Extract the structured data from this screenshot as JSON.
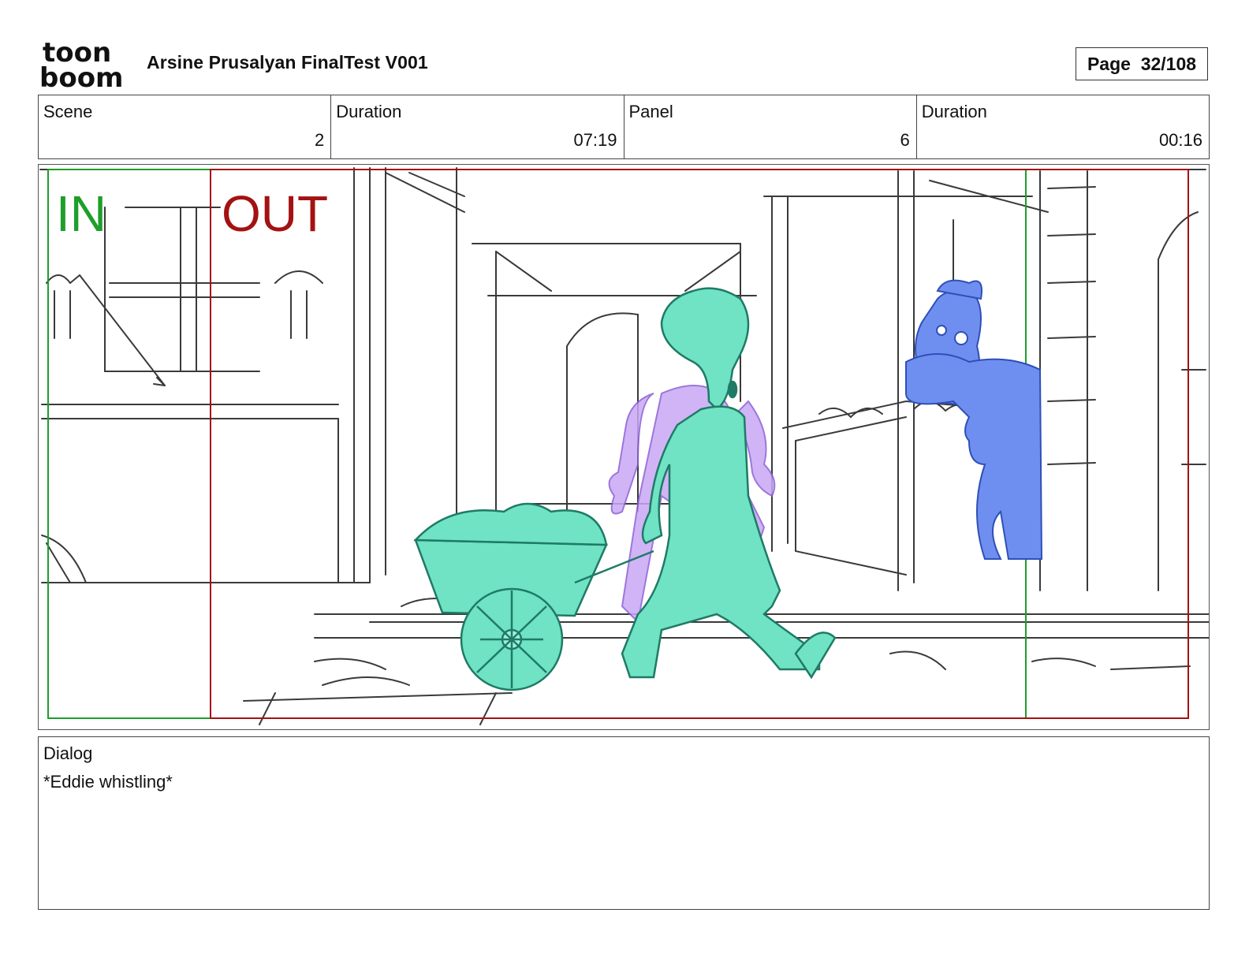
{
  "header": {
    "logo_text_top": "toon",
    "logo_text_bottom": "boom",
    "title": "Arsine Prusalyan FinalTest V001",
    "page": "Page  32/108"
  },
  "info": {
    "scene_label": "Scene",
    "scene_value": "2",
    "scene_duration_label": "Duration",
    "scene_duration_value": "07:19",
    "panel_label": "Panel",
    "panel_value": "6",
    "panel_duration_label": "Duration",
    "panel_duration_value": "00:16"
  },
  "panel": {
    "in_label": "IN",
    "out_label": "OUT",
    "colors": {
      "in": "#1e9e2a",
      "out": "#a31212",
      "squidward": "#6fe3c4",
      "squidward_line": "#1f7a66",
      "ghost": "#c9a8f5",
      "ghost_line": "#8b5fd6",
      "vendor": "#6f8ff0",
      "vendor_line": "#2f4fb8",
      "sketch": "#3a3a3a"
    }
  },
  "dialog": {
    "label": "Dialog",
    "text": "*Eddie whistling*"
  }
}
